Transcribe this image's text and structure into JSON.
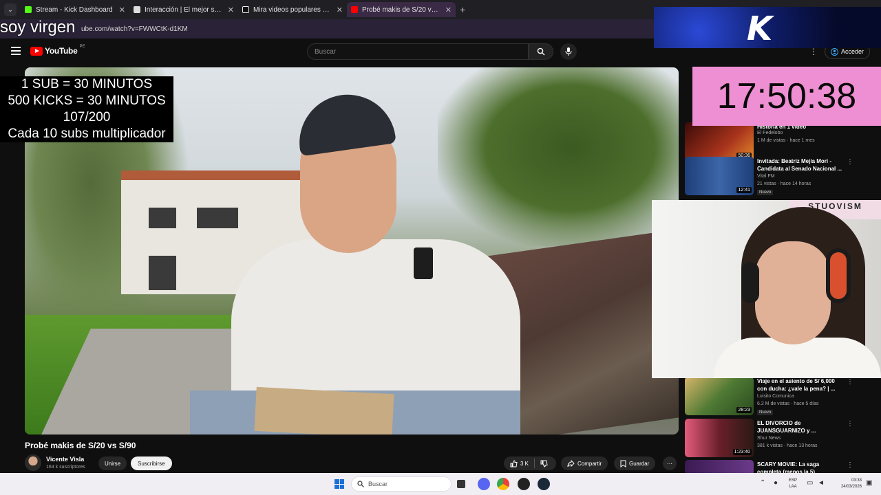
{
  "browser": {
    "tabs": [
      {
        "label": "Stream - Kick Dashboard",
        "color": "#53fc18"
      },
      {
        "label": "Interacción | El mejor software para",
        "color": "#ffffff"
      },
      {
        "label": "Mira videos populares seleccionados",
        "color": "#ffffff"
      },
      {
        "label": "Probé makis de S/20 vs S/90 - YouTube",
        "color": "#ff0000"
      }
    ],
    "url": "ube.com/watch?v=FWWCtK-d1KM"
  },
  "youtube": {
    "logo_text": "YouTube",
    "country_code": "PE",
    "search_placeholder": "Buscar",
    "signin_label": "Acceder",
    "video": {
      "title": "Probé makis de S/20 vs S/90",
      "channel": "Vicente Visla",
      "subscribers": "163 k suscriptores",
      "join_label": "Unirse",
      "subscribe_label": "Suscribirse",
      "likes": "3 K",
      "share_label": "Compartir",
      "save_label": "Guardar"
    },
    "recommendations": [
      {
        "title": "Historia en 1 video",
        "channel": "El Fedelobo",
        "meta": "1 M de vistas · hace 1 mes",
        "duration": "50:36",
        "badge": "",
        "thumb_color": "#7a1e14"
      },
      {
        "title": "Invitada: Beatriz Mejía Mori - Candidata al Senado Nacional ...",
        "channel": "Vital FM",
        "meta": "21 vistas · hace 14 horas",
        "duration": "12:41",
        "badge": "Nuevo",
        "thumb_color": "#2b4f8a"
      },
      {
        "title": "Viaje en el asiento de S/ 6,000 con ducha: ¿vale la pena? | ...",
        "channel": "Luisito Comunica",
        "meta": "6.2 M de vistas · hace 5 días",
        "duration": "28:23",
        "badge": "Nuevo",
        "thumb_color": "#3f6b2a"
      },
      {
        "title": "EL DIVORCIO de JUANSGUARNIZO y ...",
        "channel": "Shur News",
        "meta": "381 k vistas · hace 13 horas",
        "duration": "1:23:40",
        "badge": "",
        "thumb_color": "#8a2d3d"
      },
      {
        "title": "SCARY MOVIE: La saga completa (menos la 5)",
        "channel": "",
        "meta": "",
        "duration": "",
        "badge": "",
        "thumb_color": "#5b2d7a"
      }
    ]
  },
  "overlay": {
    "top_text": "soy virgen",
    "rules": [
      "1 SUB     = 30 MINUTOS",
      "500 KICKS = 30 MINUTOS",
      "107/200",
      "Cada 10 subs multiplicador"
    ],
    "timer": "17:50:38",
    "cam_banner": "STUOVISM"
  },
  "taskbar": {
    "search_placeholder": "Buscar",
    "lang_line1": "ESP",
    "lang_line2": "LAA",
    "time": "03:33",
    "date": "24/03/2026"
  }
}
